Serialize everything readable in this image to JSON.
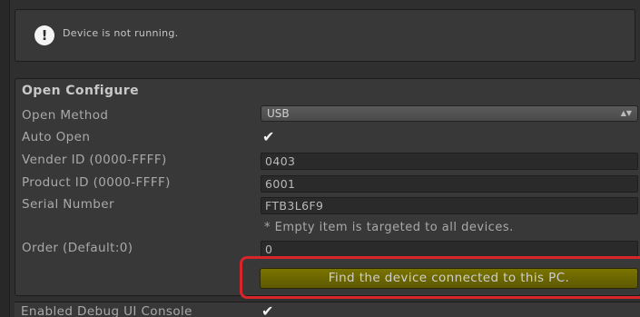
{
  "helpbox": {
    "icon": "warning-icon",
    "message": "Device is not running."
  },
  "open_configure": {
    "title": "Open Configure",
    "open_method": {
      "label": "Open Method",
      "value": "USB"
    },
    "auto_open": {
      "label": "Auto Open",
      "checked": true
    },
    "vender_id": {
      "label": "Vender ID (0000-FFFF)",
      "value": "0403"
    },
    "product_id": {
      "label": "Product ID (0000-FFFF)",
      "value": "6001"
    },
    "serial_number": {
      "label": "Serial Number",
      "value": "FTB3L6F9"
    },
    "hint": "* Empty item is targeted to all devices.",
    "order": {
      "label": "Order (Default:0)",
      "value": "0"
    },
    "find_button": "Find the device connected to this PC."
  },
  "debug_console": {
    "label": "Enabled Debug UI Console",
    "checked": true
  },
  "colors": {
    "highlight": "#d8242b",
    "button_accent": "#6b6500"
  }
}
